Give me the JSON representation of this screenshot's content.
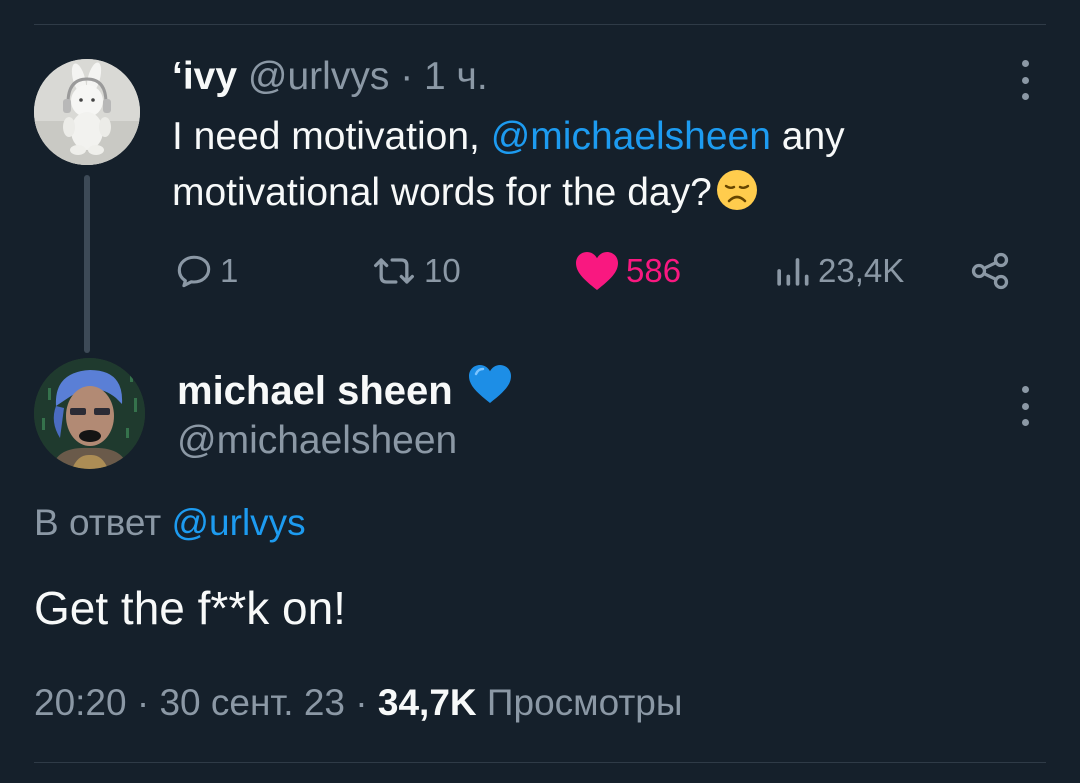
{
  "parent_tweet": {
    "display_name": "‘ivy",
    "handle": "@urlvys",
    "separator": "·",
    "time": "1 ч.",
    "text_before": "I need motivation,",
    "mention": "@michaelsheen",
    "text_after": "any motivational words for the day?",
    "emoji": "disappointed-face-emoji",
    "actions": {
      "replies": "1",
      "reposts": "10",
      "likes": "586",
      "views": "23,4K"
    }
  },
  "reply_tweet": {
    "display_name": "michael sheen",
    "badge_icon": "blue-heart-emoji",
    "handle": "@michaelsheen",
    "reply_to_label": "В ответ",
    "reply_to_handle": "@urlvys",
    "text": "Get the f**k on!",
    "time": "20:20",
    "date": "30 сент. 23",
    "separator": "·",
    "views_count": "34,7K",
    "views_label": "Просмотры"
  },
  "colors": {
    "background": "#15202b",
    "accent": "#1d9bf0",
    "like": "#f91880",
    "muted": "#8b98a5",
    "text": "#f7f9f9"
  }
}
